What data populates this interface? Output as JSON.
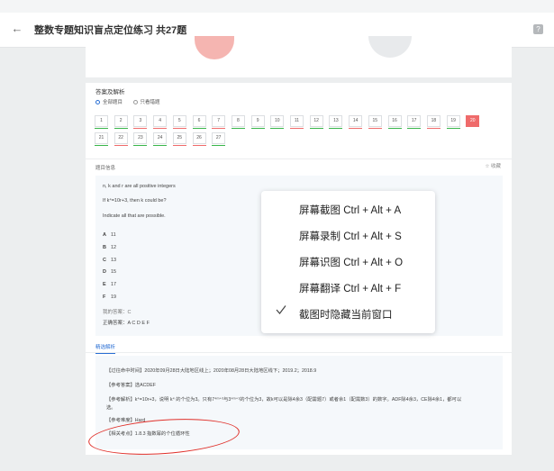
{
  "header": {
    "title": "整数专题知识盲点定位练习 共27题",
    "back_icon": "←",
    "help_icon": "?"
  },
  "answer_section": {
    "title": "答案及解析",
    "filter_all": "全部题目",
    "filter_wrong": "只看错题",
    "numbers": [
      {
        "n": "1",
        "status": "green"
      },
      {
        "n": "2",
        "status": "green"
      },
      {
        "n": "3",
        "status": "red"
      },
      {
        "n": "4",
        "status": "red"
      },
      {
        "n": "5",
        "status": "red"
      },
      {
        "n": "6",
        "status": "green"
      },
      {
        "n": "7",
        "status": "red"
      },
      {
        "n": "8",
        "status": "green"
      },
      {
        "n": "9",
        "status": "green"
      },
      {
        "n": "10",
        "status": "green"
      },
      {
        "n": "11",
        "status": "red"
      },
      {
        "n": "12",
        "status": "green"
      },
      {
        "n": "13",
        "status": "green"
      },
      {
        "n": "14",
        "status": "red"
      },
      {
        "n": "15",
        "status": "red"
      },
      {
        "n": "16",
        "status": "green"
      },
      {
        "n": "17",
        "status": "green"
      },
      {
        "n": "18",
        "status": "red"
      },
      {
        "n": "19",
        "status": "green"
      },
      {
        "n": "20",
        "status": "current"
      },
      {
        "n": "21",
        "status": "green"
      },
      {
        "n": "22",
        "status": "red"
      },
      {
        "n": "23",
        "status": "green"
      },
      {
        "n": "24",
        "status": "green"
      },
      {
        "n": "25",
        "status": "red"
      },
      {
        "n": "26",
        "status": "red"
      },
      {
        "n": "27",
        "status": "green"
      }
    ]
  },
  "question": {
    "info_label": "题目信息",
    "favorite": "☆ 收藏",
    "line1": "n, k and r are all positive integers",
    "line2": "If k⁴=10r+3, then k could be?",
    "line3": "Indicate all that are possible.",
    "options": [
      {
        "letter": "A",
        "value": "11"
      },
      {
        "letter": "B",
        "value": "12"
      },
      {
        "letter": "C",
        "value": "13"
      },
      {
        "letter": "D",
        "value": "15"
      },
      {
        "letter": "E",
        "value": "17"
      },
      {
        "letter": "F",
        "value": "19"
      }
    ],
    "my_answer": "我的答案：C",
    "correct_answer": "正确答案：A C D E F"
  },
  "analysis": {
    "tab": "精选解析",
    "lines": [
      "【过往命中时间】2020年09月28日大陆地区线上；2020年08月28日大陆地区线下；2019.2；2018.9",
      "【参考答案】选ACDEF",
      "【参考解析】k⁴=10r+3，说明 k⁴ 的个位为3。只有7⁴ᵐ⁺³与3⁴ᵐ⁺¹的个位为3，故k可以是除4余3（配需题7）或者余1（配需数3）的数字。ADF除4余3，CE除4余1，都可以",
      "选。",
      "【参考难度】Hard",
      "【相关考点】1.8.3 指数幂的个位循环性"
    ]
  },
  "context_menu": {
    "items": [
      "屏幕截图 Ctrl + Alt + A",
      "屏幕录制 Ctrl + Alt + S",
      "屏幕识图 Ctrl + Alt + O",
      "屏幕翻译 Ctrl + Alt + F"
    ],
    "toggle": "截图时隐藏当前窗口"
  },
  "colors": {
    "green": "#39b54a",
    "red": "#ef6b6b",
    "accent": "#2a6fd4"
  }
}
